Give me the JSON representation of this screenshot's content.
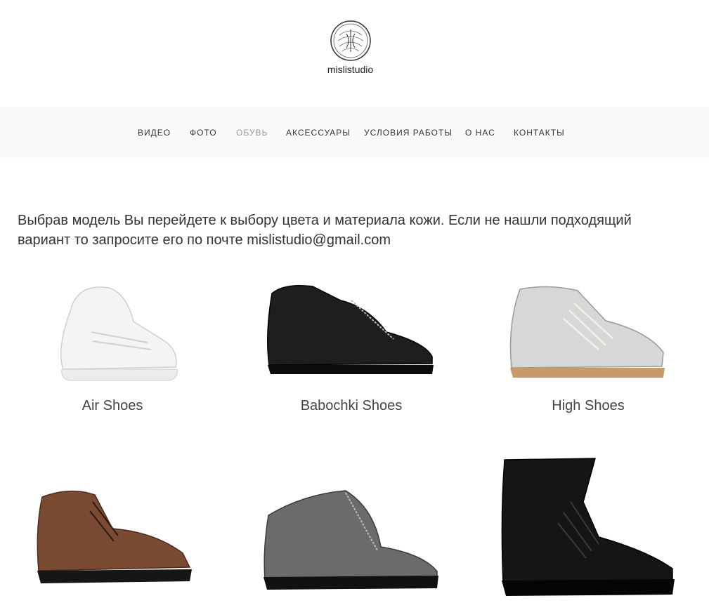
{
  "brand": {
    "name": "mislistudio",
    "logo_icon": "circular-emblem-logo"
  },
  "nav": {
    "items": [
      {
        "label": "ВИДЕО"
      },
      {
        "label": "ФОТО"
      },
      {
        "label": "ОБУВЬ",
        "active": true
      },
      {
        "label": "АКСЕССУАРЫ"
      },
      {
        "label": "УСЛОВИЯ РАБОТЫ"
      },
      {
        "label": "О НАС"
      },
      {
        "label": "КОНТАКТЫ"
      }
    ]
  },
  "intro": {
    "line1": "Выбрав модель Вы перейдете к выбору цвета и материала кожи. Если не нашли подходящий",
    "line2": "вариант то запросите его по почте mislistudio@gmail.com"
  },
  "products": [
    {
      "name": "Air Shoes",
      "color": "#f2f2f2"
    },
    {
      "name": "Babochki Shoes",
      "color": "#1e1e1e"
    },
    {
      "name": "High Shoes",
      "color": "#c8c8c8"
    },
    {
      "name": "",
      "color": "#7a4a33"
    },
    {
      "name": "",
      "color": "#6b6b6b"
    },
    {
      "name": "",
      "color": "#151515"
    }
  ]
}
